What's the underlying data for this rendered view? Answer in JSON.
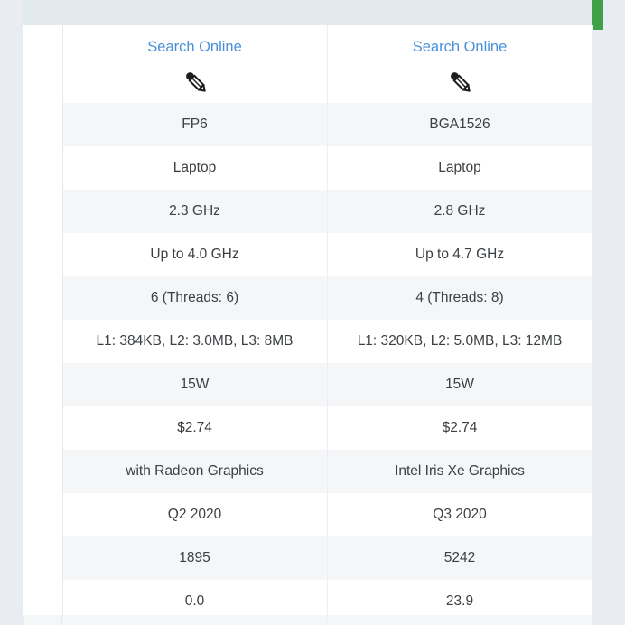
{
  "colors": {
    "page_background": "#e9edf3",
    "table_background": "#ffffff",
    "header_band": "#e3eaef",
    "row_stripe": "#f5f6f7",
    "link": "#4a90d9",
    "text": "#3c4043",
    "scroll_indicator": "#41a04a"
  },
  "scroll_indicator": {
    "name": "scroll-position-indicator",
    "color": "#41a04a"
  },
  "table": {
    "columns": [
      {
        "key": "label",
        "label": ""
      },
      {
        "key": "cpu_a",
        "label": ""
      },
      {
        "key": "cpu_b",
        "label": ""
      }
    ],
    "rows": [
      {
        "type": "actions",
        "stripe": "white",
        "label": "",
        "cpu_a": {
          "link_label": "Search Online",
          "icon": "pencil-icon"
        },
        "cpu_b": {
          "link_label": "Search Online",
          "icon": "pencil-icon"
        }
      },
      {
        "type": "text",
        "stripe": "gray",
        "label": "",
        "cpu_a": "FP6",
        "cpu_b": "BGA1526"
      },
      {
        "type": "text",
        "stripe": "white",
        "label": "",
        "cpu_a": "Laptop",
        "cpu_b": "Laptop"
      },
      {
        "type": "text",
        "stripe": "gray",
        "label": "",
        "cpu_a": "2.3 GHz",
        "cpu_b": "2.8 GHz"
      },
      {
        "type": "text",
        "stripe": "white",
        "label": "",
        "cpu_a": "Up to 4.0 GHz",
        "cpu_b": "Up to 4.7 GHz"
      },
      {
        "type": "text",
        "stripe": "gray",
        "label": "",
        "cpu_a": "6 (Threads: 6)",
        "cpu_b": "4 (Threads: 8)"
      },
      {
        "type": "text",
        "stripe": "white",
        "label": "",
        "cpu_a": "L1: 384KB, L2: 3.0MB, L3: 8MB",
        "cpu_b": "L1: 320KB, L2: 5.0MB, L3: 12MB"
      },
      {
        "type": "text",
        "stripe": "gray",
        "label": "",
        "cpu_a": "15W",
        "cpu_b": "15W"
      },
      {
        "type": "text",
        "stripe": "white",
        "label": "",
        "cpu_a": "$2.74",
        "cpu_b": "$2.74"
      },
      {
        "type": "text",
        "stripe": "gray",
        "label": "",
        "cpu_a": "with Radeon Graphics",
        "cpu_b": "Intel Iris Xe Graphics"
      },
      {
        "type": "text",
        "stripe": "white",
        "label": "",
        "cpu_a": "Q2 2020",
        "cpu_b": "Q3 2020"
      },
      {
        "type": "text",
        "stripe": "gray",
        "label": "",
        "cpu_a": "1895",
        "cpu_b": "5242"
      },
      {
        "type": "text",
        "stripe": "white",
        "label": "",
        "cpu_a": "0.0",
        "cpu_b": "23.9"
      }
    ]
  }
}
